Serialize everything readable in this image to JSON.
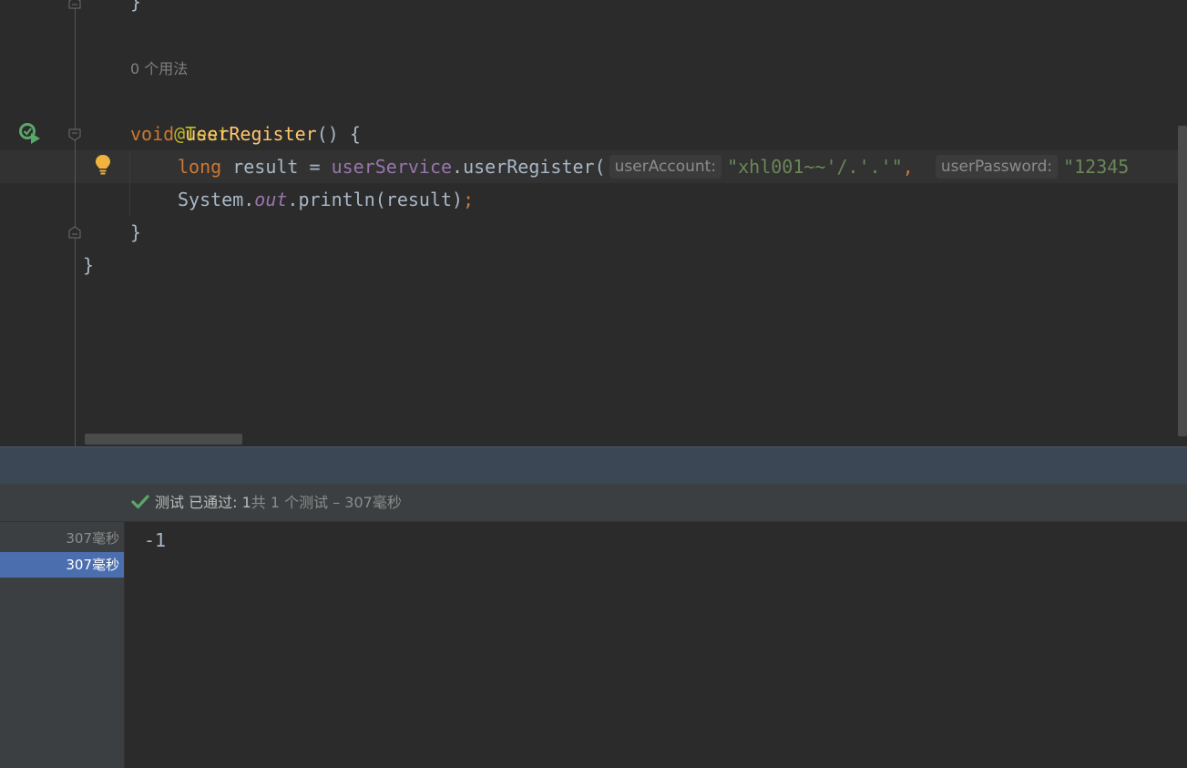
{
  "editor": {
    "usages_hint": "0 个用法",
    "annotation": "@Test",
    "method_decl": {
      "return_type": "void",
      "name": "userRegister",
      "signature_rest": "() {"
    },
    "line_result": {
      "type_kw": "long",
      "var": " result = ",
      "service": "userService",
      "call": ".userRegister(",
      "hint_account": "userAccount:",
      "arg_account": "\"xhl001~~'/.'.'\"",
      "comma": ",",
      "hint_password": "userPassword:",
      "arg_password": "\"12345"
    },
    "line_print": {
      "system": "System.",
      "out": "out",
      "println": ".println(result)",
      "semicolon": ";"
    },
    "close_method": "}",
    "close_class": "}",
    "top_brace": "}"
  },
  "test_status": {
    "label_test": "测试 已通过: 1",
    "label_summary": "共 1 个测试 – 307毫秒"
  },
  "test_tree": {
    "rows": [
      {
        "label": "307毫秒"
      },
      {
        "label": "307毫秒"
      }
    ]
  },
  "console": {
    "output": "-1"
  },
  "colors": {
    "keyword": "#cc7832",
    "method": "#ffc66d",
    "annotation": "#bbb529",
    "field": "#9876aa",
    "string": "#6a8759",
    "pass": "#59a869",
    "selection": "#4b6eaf"
  }
}
